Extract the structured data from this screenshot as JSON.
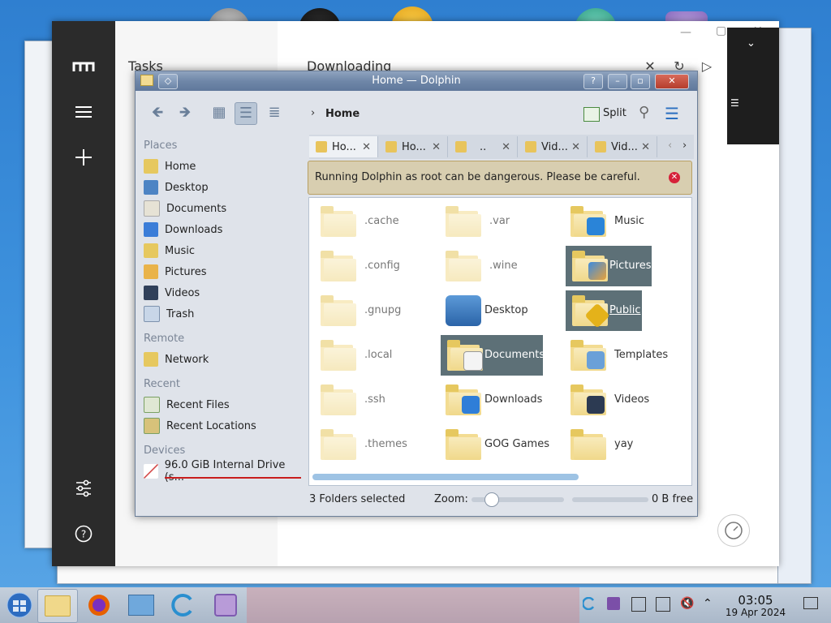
{
  "tasks_app": {
    "list_title": "Tasks",
    "detail_title": "Downloading"
  },
  "dolphin": {
    "title": "Home — Dolphin",
    "breadcrumb": "Home",
    "split_label": "Split",
    "tabs": [
      {
        "label": "Ho..."
      },
      {
        "label": "Ho..."
      },
      {
        "label": ".."
      },
      {
        "label": "Vid..."
      },
      {
        "label": "Vid..."
      }
    ],
    "warning": "Running Dolphin as root can be dangerous. Please be careful.",
    "places": {
      "heading": "Places",
      "items": [
        "Home",
        "Desktop",
        "Documents",
        "Downloads",
        "Music",
        "Pictures",
        "Videos",
        "Trash"
      ]
    },
    "remote": {
      "heading": "Remote",
      "items": [
        "Network"
      ]
    },
    "recent": {
      "heading": "Recent",
      "items": [
        "Recent Files",
        "Recent Locations"
      ]
    },
    "devices": {
      "heading": "Devices",
      "items": [
        "96.0 GiB Internal Drive (s..."
      ]
    },
    "files": [
      {
        "name": ".cache",
        "hidden": true
      },
      {
        "name": ".var",
        "hidden": true
      },
      {
        "name": "Music",
        "hidden": false,
        "icon": "music-folder-icon"
      },
      {
        "name": ".config",
        "hidden": true
      },
      {
        "name": ".wine",
        "hidden": true
      },
      {
        "name": "Pictures",
        "hidden": false,
        "selected": true,
        "icon": "pictures-folder-icon"
      },
      {
        "name": ".gnupg",
        "hidden": true
      },
      {
        "name": "Desktop",
        "hidden": false,
        "icon": "desktop-folder-icon"
      },
      {
        "name": "Public",
        "hidden": false,
        "selected": true,
        "icon": "public-folder-icon"
      },
      {
        "name": ".local",
        "hidden": true
      },
      {
        "name": "Documents",
        "hidden": false,
        "selected": true,
        "icon": "documents-folder-icon"
      },
      {
        "name": "Templates",
        "hidden": false,
        "icon": "templates-folder-icon"
      },
      {
        "name": ".ssh",
        "hidden": true
      },
      {
        "name": "Downloads",
        "hidden": false,
        "icon": "downloads-folder-icon"
      },
      {
        "name": "Videos",
        "hidden": false,
        "icon": "videos-folder-icon"
      },
      {
        "name": ".themes",
        "hidden": true
      },
      {
        "name": "GOG Games",
        "hidden": false
      },
      {
        "name": "yay",
        "hidden": false
      }
    ],
    "status_text": "3 Folders selected",
    "zoom_label": "Zoom:",
    "free_space": "0 B free"
  },
  "taskbar": {
    "time": "03:05",
    "date": "19 Apr 2024"
  },
  "colors": {
    "selection": "#5d7077",
    "titlebar": "#6f87a8",
    "warning_bg": "#d8ceb0",
    "drive_underline": "#c91d1d"
  }
}
